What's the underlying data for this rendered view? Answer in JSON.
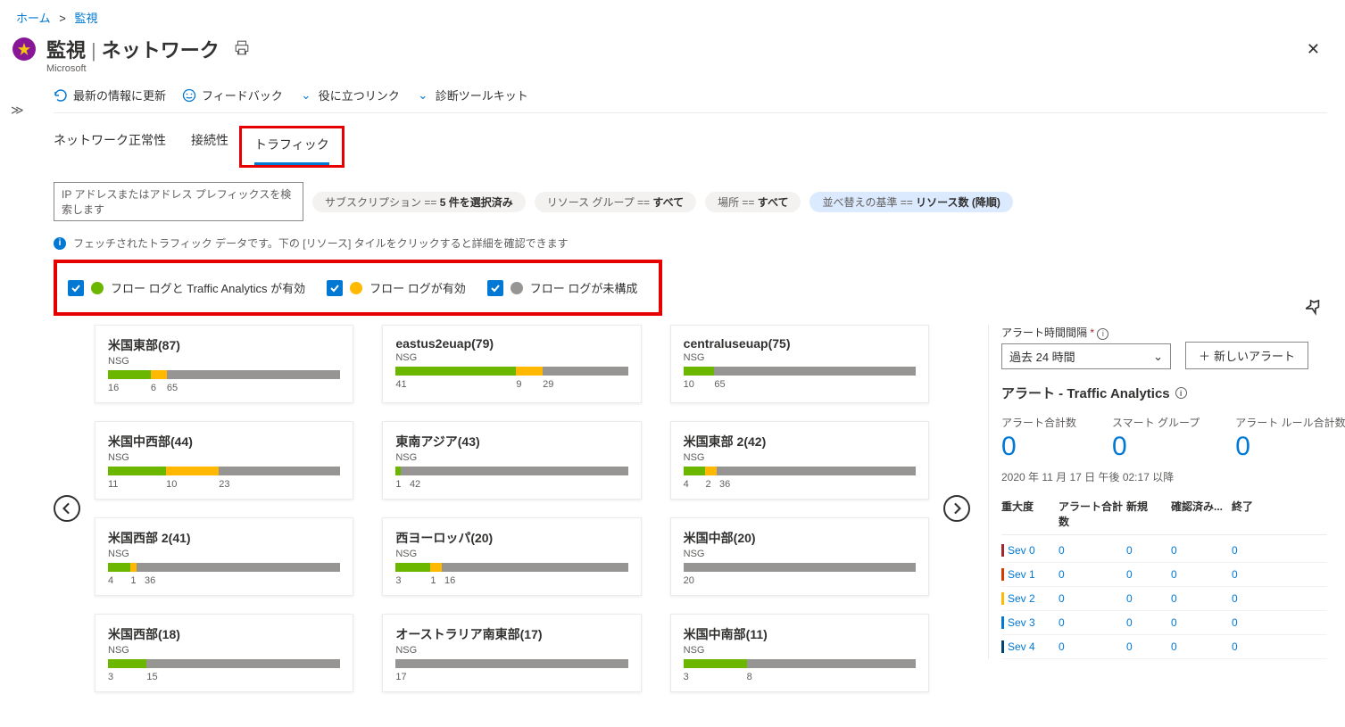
{
  "breadcrumb": {
    "home": "ホーム",
    "current": "監視"
  },
  "header": {
    "title": "監視",
    "subtitle_part": "ネットワーク",
    "company": "Microsoft"
  },
  "toolbar": {
    "refresh": "最新の情報に更新",
    "feedback": "フィードバック",
    "links": "役に立つリンク",
    "diag": "診断ツールキット"
  },
  "tabs": {
    "t1": "ネットワーク正常性",
    "t2": "接続性",
    "t3": "トラフィック"
  },
  "filters": {
    "search_placeholder": "IP アドレスまたはアドレス プレフィックスを検索します",
    "sub_label": "サブスクリプション == ",
    "sub_value": "5 件を選択済み",
    "rg_label": "リソース グループ == ",
    "rg_value": "すべて",
    "loc_label": "場所 == ",
    "loc_value": "すべて",
    "sort_label": "並べ替えの基準 == ",
    "sort_value": "リソース数 (降順)"
  },
  "info_text": "フェッチされたトラフィック データです。下の [リソース] タイルをクリックすると詳細を確認できます",
  "legend": {
    "l1": "フロー ログと Traffic Analytics が有効",
    "l2": "フロー ログが有効",
    "l3": "フロー ログが未構成"
  },
  "cards": [
    {
      "title": "米国東部(87)",
      "sub": "NSG",
      "g": 16,
      "y": 6,
      "gr": 65
    },
    {
      "title": "eastus2euap(79)",
      "sub": "NSG",
      "g": 41,
      "y": 9,
      "gr": 29
    },
    {
      "title": "centraluseuap(75)",
      "sub": "NSG",
      "g": 10,
      "y": 0,
      "gr": 65
    },
    {
      "title": "米国中西部(44)",
      "sub": "NSG",
      "g": 11,
      "y": 10,
      "gr": 23
    },
    {
      "title": "東南アジア(43)",
      "sub": "NSG",
      "g": 1,
      "y": 0,
      "gr": 42
    },
    {
      "title": "米国東部 2(42)",
      "sub": "NSG",
      "g": 4,
      "y": 2,
      "gr": 36
    },
    {
      "title": "米国西部 2(41)",
      "sub": "NSG",
      "g": 4,
      "y": 1,
      "gr": 36
    },
    {
      "title": "西ヨーロッパ(20)",
      "sub": "NSG",
      "g": 3,
      "y": 1,
      "gr": 16
    },
    {
      "title": "米国中部(20)",
      "sub": "NSG",
      "g": 0,
      "y": 0,
      "gr": 20
    },
    {
      "title": "米国西部(18)",
      "sub": "NSG",
      "g": 3,
      "y": 0,
      "gr": 15
    },
    {
      "title": "オーストラリア南東部(17)",
      "sub": "NSG",
      "g": 0,
      "y": 0,
      "gr": 17
    },
    {
      "title": "米国中南部(11)",
      "sub": "NSG",
      "g": 3,
      "y": 0,
      "gr": 8
    }
  ],
  "right": {
    "interval_label": "アラート時間間隔",
    "interval_value": "過去 24 時間",
    "new_alert": "新しいアラート",
    "title": "アラート - Traffic Analytics",
    "m1_label": "アラート合計数",
    "m1_value": "0",
    "m2_label": "スマート グループ",
    "m2_value": "0",
    "m3_label": "アラート ルール合計数",
    "m3_value": "0",
    "since": "2020 年 11 月 17 日 午後 02:17 以降",
    "head": {
      "c1": "重大度",
      "c2": "アラート合計数",
      "c3": "新規",
      "c4": "確認済み...",
      "c5": "終了"
    },
    "rows": [
      {
        "name": "Sev 0",
        "cls": "sev0",
        "a": "0",
        "b": "0",
        "c": "0",
        "d": "0"
      },
      {
        "name": "Sev 1",
        "cls": "sev1",
        "a": "0",
        "b": "0",
        "c": "0",
        "d": "0"
      },
      {
        "name": "Sev 2",
        "cls": "sev2",
        "a": "0",
        "b": "0",
        "c": "0",
        "d": "0"
      },
      {
        "name": "Sev 3",
        "cls": "sev3",
        "a": "0",
        "b": "0",
        "c": "0",
        "d": "0"
      },
      {
        "name": "Sev 4",
        "cls": "sev4",
        "a": "0",
        "b": "0",
        "c": "0",
        "d": "0"
      }
    ]
  }
}
